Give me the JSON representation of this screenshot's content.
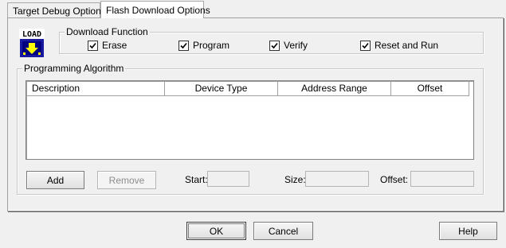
{
  "tabs": [
    {
      "label": "Target Debug Options",
      "active": false
    },
    {
      "label": "Flash Download Options",
      "active": true
    }
  ],
  "load_icon": {
    "icon": "load-icon",
    "text": "LOAD"
  },
  "download_function": {
    "title": "Download Function",
    "options": [
      {
        "label": "Erase",
        "checked": true
      },
      {
        "label": "Program",
        "checked": true
      },
      {
        "label": "Verify",
        "checked": true
      },
      {
        "label": "Reset and Run",
        "checked": true
      }
    ]
  },
  "programming_algorithm": {
    "title": "Programming Algorithm",
    "columns": [
      "Description",
      "Device Type",
      "Address Range",
      "Offset"
    ],
    "rows": [],
    "add_label": "Add",
    "remove_label": "Remove",
    "start_label": "Start:",
    "start_value": "",
    "size_label": "Size:",
    "size_value": "",
    "offset_label": "Offset:",
    "offset_value": ""
  },
  "footer": {
    "ok_label": "OK",
    "cancel_label": "Cancel",
    "help_label": "Help"
  }
}
